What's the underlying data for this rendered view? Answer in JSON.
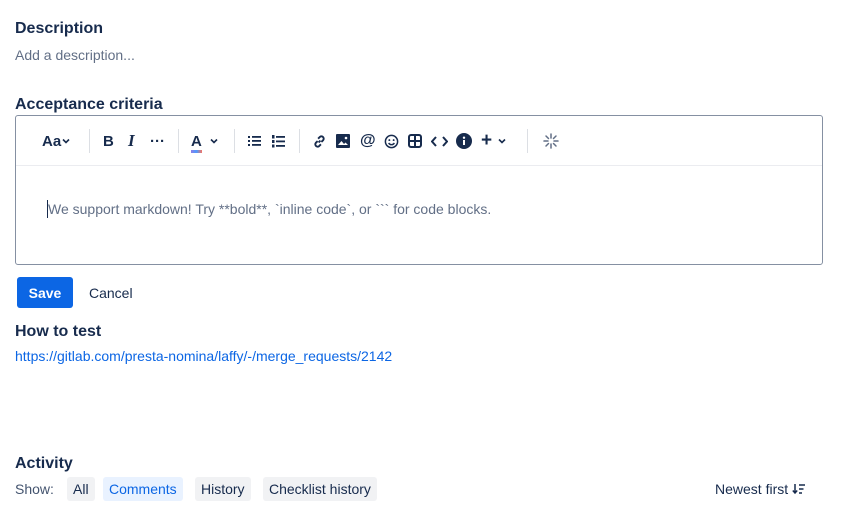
{
  "description": {
    "heading": "Description",
    "placeholder": "Add a description..."
  },
  "acceptance": {
    "heading": "Acceptance criteria",
    "editor_placeholder": "We support markdown! Try **bold**, `inline code`, or ``` for code blocks.",
    "toolbar": {
      "text_style": "Aa",
      "bold": "B",
      "italic": "I",
      "more": "···",
      "text_color": "A",
      "insert": "+"
    }
  },
  "actions": {
    "save": "Save",
    "cancel": "Cancel"
  },
  "how_to_test": {
    "heading": "How to test",
    "link": "https://gitlab.com/presta-nomina/laffy/-/merge_requests/2142"
  },
  "activity": {
    "heading": "Activity",
    "show_label": "Show:",
    "filters": [
      {
        "label": "All",
        "active": false
      },
      {
        "label": "Comments",
        "active": true
      },
      {
        "label": "History",
        "active": false
      },
      {
        "label": "Checklist history",
        "active": false
      }
    ],
    "sort": "Newest first"
  },
  "colors": {
    "primary": "#0c66e4",
    "text": "#172b4d",
    "muted": "#626f86"
  }
}
